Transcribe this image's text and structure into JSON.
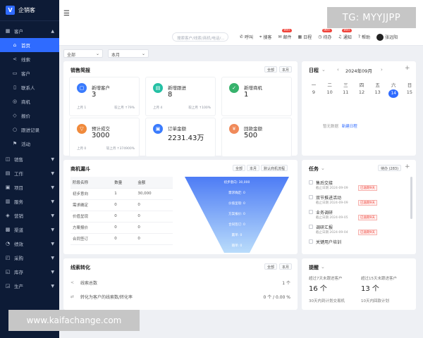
{
  "app": {
    "name": "企销客",
    "logo_letter": "V"
  },
  "sidebar": {
    "top": {
      "label": "客户",
      "icon": "grid-icon"
    },
    "sub": [
      {
        "label": "首页",
        "icon": "home-icon",
        "active": true
      },
      {
        "label": "线索",
        "icon": "share-icon"
      },
      {
        "label": "客户",
        "icon": "doc-icon"
      },
      {
        "label": "联系人",
        "icon": "user-icon"
      },
      {
        "label": "商机",
        "icon": "target-icon"
      },
      {
        "label": "报价",
        "icon": "shield-icon"
      },
      {
        "label": "跟进记录",
        "icon": "chat-icon"
      },
      {
        "label": "活动",
        "icon": "flag-icon"
      }
    ],
    "groups": [
      {
        "label": "销售",
        "icon": "cart-icon"
      },
      {
        "label": "工作",
        "icon": "doc-icon"
      },
      {
        "label": "项目",
        "icon": "folder-icon"
      },
      {
        "label": "服务",
        "icon": "service-icon"
      },
      {
        "label": "营销",
        "icon": "megaphone-icon"
      },
      {
        "label": "渠道",
        "icon": "channel-icon"
      },
      {
        "label": "绩效",
        "icon": "chart-icon"
      },
      {
        "label": "采购",
        "icon": "bag-icon"
      },
      {
        "label": "库存",
        "icon": "box-icon"
      },
      {
        "label": "生产",
        "icon": "factory-icon"
      }
    ]
  },
  "topbar": {
    "search_placeholder": "搜索客户/线索/商机/电话/...",
    "actions": [
      {
        "label": "呼叫",
        "icon": "phone-icon"
      },
      {
        "label": "搜客",
        "icon": "location-icon"
      },
      {
        "label": "邮件",
        "icon": "mail-icon",
        "badge": "99+"
      },
      {
        "label": "日程",
        "icon": "calendar-icon"
      },
      {
        "label": "待办",
        "icon": "clock-icon",
        "badge": "99+"
      },
      {
        "label": "通知",
        "icon": "bell-icon",
        "badge": "99+"
      },
      {
        "label": "帮助",
        "icon": "help-icon"
      }
    ],
    "user": "张远阳"
  },
  "watermarks": {
    "top": "TG: MYYJJPP",
    "bottom": "www.kaifachange.com"
  },
  "filters": {
    "scope": "全部",
    "period": "本月"
  },
  "sales_brief": {
    "title": "销售简报",
    "chip_all": "全部",
    "chip_period": "本月",
    "stats": [
      {
        "label": "新增客户",
        "value": "3",
        "foot_left": "上月 1",
        "foot_right": "较上月 ↑79%",
        "icon": "chat-icon",
        "color": "#3a7bfd"
      },
      {
        "label": "新增跟进",
        "value": "8",
        "foot_left": "上月 4",
        "foot_right": "较上月 ↑100%",
        "icon": "doc-icon",
        "color": "#24c0a4"
      },
      {
        "label": "新增商机",
        "value": "1",
        "foot_left": "",
        "foot_right": "",
        "icon": "check-icon",
        "color": "#37b26c"
      },
      {
        "label": "预计成交",
        "value": "3000",
        "foot_left": "上月 0",
        "foot_right": "较上月 ↑374900%",
        "icon": "arrow-down-icon",
        "color": "#f08a3c"
      },
      {
        "label": "订单金额",
        "value": "2231.43万",
        "foot_left": "",
        "foot_right": "",
        "icon": "wallet-icon",
        "color": "#3a7bfd"
      },
      {
        "label": "回款金额",
        "value": "500",
        "foot_left": "",
        "foot_right": "",
        "icon": "money-icon",
        "color": "#f08a5a"
      }
    ]
  },
  "calendar": {
    "title": "日程",
    "month": "2024年09月",
    "weekdays": [
      "一",
      "二",
      "三",
      "四",
      "五",
      "六",
      "日"
    ],
    "days": [
      "9",
      "10",
      "11",
      "12",
      "13",
      "14",
      "15"
    ],
    "today_index": 5,
    "empty_text": "暂无数据",
    "new_link": "新建日程"
  },
  "funnel": {
    "title": "商机漏斗",
    "chip_all": "全部",
    "chip_period": "本月",
    "chip_flow": "默认商机流程",
    "headers": [
      "阶段名称",
      "数量",
      "金额"
    ],
    "rows": [
      [
        "初步意向",
        "1",
        "30,000"
      ],
      [
        "需求确定",
        "0",
        "0"
      ],
      [
        "价值呈现",
        "0",
        "0"
      ],
      [
        "方案报价",
        "0",
        "0"
      ],
      [
        "合同签订",
        "0",
        "0"
      ]
    ],
    "bands": [
      "初步意向: 30,000",
      "需求确定: 0",
      "价值呈现: 0",
      "方案报价: 0",
      "合同签订: 0",
      "赢单: 0",
      "输单: 0"
    ]
  },
  "tasks": {
    "title": "任务",
    "chip_count": "待办 (283)",
    "items": [
      {
        "title": "售后交接",
        "meta": "截止日期 2024-09-09",
        "overdue": "已逾期9天"
      },
      {
        "title": "双节推进活动",
        "meta": "截止日期 2024-09-09",
        "overdue": "已逾期9天"
      },
      {
        "title": "业务调研",
        "meta": "截止日期 2024-09-05",
        "overdue": "已逾期9天"
      },
      {
        "title": "调研汇报",
        "meta": "截止日期 2024-09-04",
        "overdue": "已逾期9天"
      },
      {
        "title": "关键用户培训",
        "meta": "",
        "overdue": ""
      }
    ]
  },
  "leads": {
    "title": "线索转化",
    "chip_all": "全部",
    "chip_period": "本月",
    "rows": [
      {
        "label": "线索总数",
        "value": "1 个",
        "icon": "share-icon"
      },
      {
        "label": "转化为客户的线索数/转化率",
        "value": "0 个  /  0.00 %",
        "icon": "convert-icon"
      }
    ]
  },
  "reminders": {
    "title": "提醒",
    "items": [
      {
        "label": "超过7天未跟进客户",
        "value": "16 个"
      },
      {
        "label": "超过15天未跟进客户",
        "value": "13 个"
      },
      {
        "label": "30天内到计划交易机",
        "value": ""
      },
      {
        "label": "10天内回款计划",
        "value": ""
      }
    ]
  }
}
